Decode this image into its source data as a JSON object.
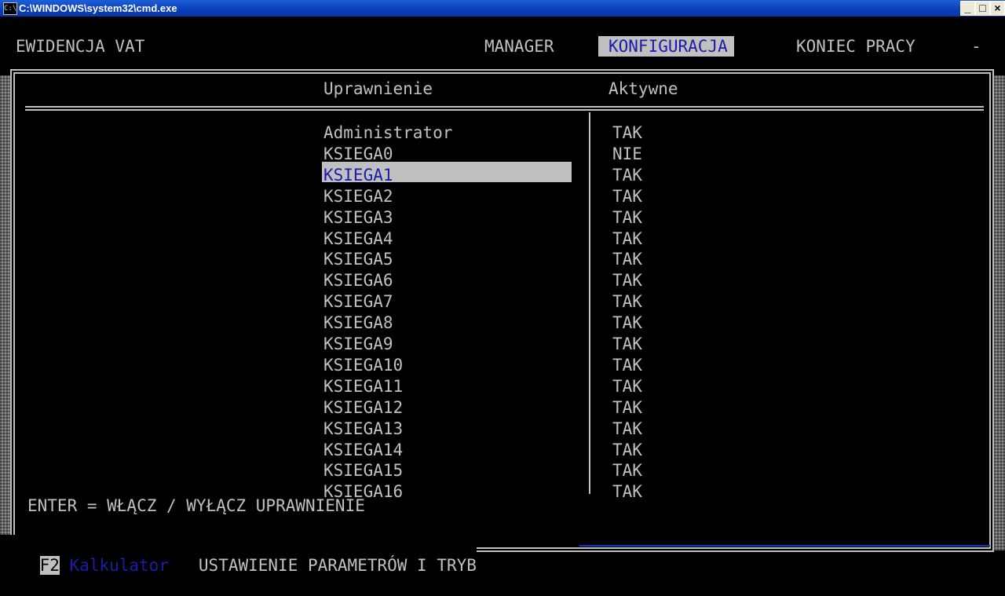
{
  "window": {
    "title": "C:\\WINDOWS\\system32\\cmd.exe",
    "icon_text": "C:\\",
    "minimize": "_",
    "maximize": "□",
    "close": "×"
  },
  "menu": {
    "app": "EWIDENCJA VAT",
    "manager": "MANAGER",
    "konfiguracja": "KONFIGURACJA",
    "koniec": "KONIEC PRACY",
    "dash": "-"
  },
  "table": {
    "col1": "Uprawnienie",
    "col2": "Aktywne",
    "rows": [
      {
        "name": "Administrator",
        "active": "TAK"
      },
      {
        "name": "KSIEGA0",
        "active": "NIE"
      },
      {
        "name": "KSIEGA1",
        "active": "TAK"
      },
      {
        "name": "KSIEGA2",
        "active": "TAK"
      },
      {
        "name": "KSIEGA3",
        "active": "TAK"
      },
      {
        "name": "KSIEGA4",
        "active": "TAK"
      },
      {
        "name": "KSIEGA5",
        "active": "TAK"
      },
      {
        "name": "KSIEGA6",
        "active": "TAK"
      },
      {
        "name": "KSIEGA7",
        "active": "TAK"
      },
      {
        "name": "KSIEGA8",
        "active": "TAK"
      },
      {
        "name": "KSIEGA9",
        "active": "TAK"
      },
      {
        "name": "KSIEGA10",
        "active": "TAK"
      },
      {
        "name": "KSIEGA11",
        "active": "TAK"
      },
      {
        "name": "KSIEGA12",
        "active": "TAK"
      },
      {
        "name": "KSIEGA13",
        "active": "TAK"
      },
      {
        "name": "KSIEGA14",
        "active": "TAK"
      },
      {
        "name": "KSIEGA15",
        "active": "TAK"
      },
      {
        "name": "KSIEGA16",
        "active": "TAK"
      }
    ]
  },
  "hint": "ENTER = WŁĄCZ / WYŁĄCZ UPRAWNIENIE",
  "statusbar": {
    "f2_key": "F2",
    "f2_label": "Kalkulator",
    "status_text": "USTAWIENIE PARAMETRÓW I TRYB"
  },
  "colors": {
    "titlebar": "#0a3fb8",
    "console_bg": "#000000",
    "console_fg": "#c0c0c0",
    "highlight_bg": "#c0c0c0",
    "highlight_fg": "#1c1ca8"
  }
}
